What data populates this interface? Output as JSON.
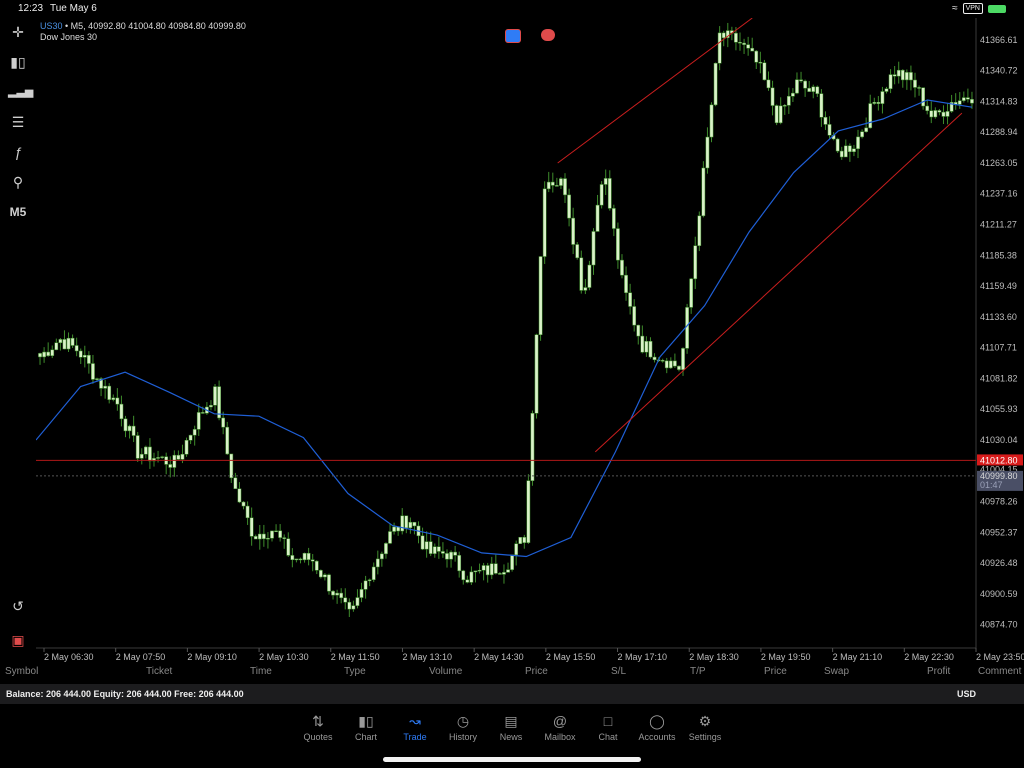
{
  "status_bar": {
    "time": "12:23",
    "date": "Tue May 6",
    "vpn": "VPN"
  },
  "chart": {
    "symbol": "US30",
    "ohlc": "• M5, 40992.80 41004.80 40984.80 40999.80",
    "name": "Dow Jones 30",
    "timeframe": "M5"
  },
  "left_toolbar": [
    "crosshair-icon",
    "candles-icon",
    "indicators-icon",
    "objects-icon",
    "function-icon",
    "search-draw-icon",
    "M5"
  ],
  "colors": {
    "bull": "#d9f2c8",
    "bear": "#d9f2c8",
    "ma": "#1f5fd6",
    "channel": "#c81e1e",
    "bid_line": "#b01818",
    "ask_line": "#555",
    "accent": "#2f7cf6"
  },
  "chart_data": {
    "type": "candlestick",
    "price_axis": [
      "41366.61",
      "41340.72",
      "41314.83",
      "41288.94",
      "41263.05",
      "41237.16",
      "41211.27",
      "41185.38",
      "41159.49",
      "41133.60",
      "41107.71",
      "41081.82",
      "41055.93",
      "41030.04",
      "40978.26",
      "40952.37",
      "40926.48",
      "40900.59",
      "40874.70"
    ],
    "bid_price": "41012.80",
    "ask_price_partial": "41004.15",
    "ask_box": "40999.80",
    "countdown": "01:47",
    "ylim": [
      40855,
      41385
    ],
    "time_axis": [
      "2 May 06:30",
      "2 May 07:50",
      "2 May 09:10",
      "2 May 10:30",
      "2 May 11:50",
      "2 May 13:10",
      "2 May 14:30",
      "2 May 15:50",
      "2 May 17:10",
      "2 May 18:30",
      "2 May 19:50",
      "2 May 21:10",
      "2 May 22:30",
      "2 May 23:50"
    ],
    "anchors": [
      41100,
      41115,
      41105,
      41080,
      41060,
      41020,
      41015,
      41010,
      41045,
      41070,
      40990,
      40950,
      40955,
      40930,
      40930,
      40905,
      40880,
      40920,
      40950,
      40965,
      40935,
      40935,
      40915,
      40920,
      40925,
      40950,
      41250,
      41245,
      41150,
      41260,
      41160,
      41110,
      41100,
      41090,
      41230,
      41370,
      41365,
      41345,
      41300,
      41330,
      41320,
      41270,
      41280,
      41315,
      41340,
      41330,
      41300,
      41315,
      41320
    ],
    "ma_anchors": [
      41030,
      41075,
      41087,
      41070,
      41052,
      41050,
      41032,
      40985,
      40958,
      40950,
      40935,
      40932,
      40948,
      41020,
      41100,
      41143,
      41205,
      41255,
      41290,
      41300,
      41316,
      41310
    ]
  },
  "positions_table": {
    "columns": [
      "Symbol",
      "Ticket",
      "Time",
      "Type",
      "Volume",
      "Price",
      "S/L",
      "T/P",
      "Price",
      "Swap",
      "Profit",
      "Comment"
    ]
  },
  "account": {
    "balance_text": "Balance: 206 444.00  Equity: 206 444.00  Free: 206 444.00",
    "currency": "USD"
  },
  "tabbar": [
    {
      "label": "Quotes",
      "icon": "quotes-icon"
    },
    {
      "label": "Chart",
      "icon": "chart-icon"
    },
    {
      "label": "Trade",
      "icon": "trade-icon",
      "active": true
    },
    {
      "label": "History",
      "icon": "history-icon"
    },
    {
      "label": "News",
      "icon": "news-icon"
    },
    {
      "label": "Mailbox",
      "icon": "mailbox-icon"
    },
    {
      "label": "Chat",
      "icon": "chat-icon"
    },
    {
      "label": "Accounts",
      "icon": "accounts-icon"
    },
    {
      "label": "Settings",
      "icon": "settings-icon"
    }
  ]
}
